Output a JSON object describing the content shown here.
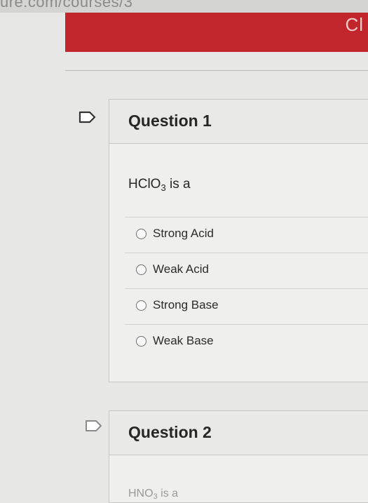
{
  "browser": {
    "url_fragment": "ure.com/courses/3"
  },
  "banner": {
    "corner_glyph": "Cl",
    "color": "#c0262c"
  },
  "questions": [
    {
      "title": "Question 1",
      "stem_prefix": "HClO",
      "stem_subscript": "3",
      "stem_suffix": " is a",
      "options": [
        {
          "label": "Strong Acid",
          "selected": false
        },
        {
          "label": "Weak Acid",
          "selected": false
        },
        {
          "label": "Strong Base",
          "selected": false
        },
        {
          "label": "Weak Base",
          "selected": false
        }
      ],
      "flag_icon": "flag-icon"
    },
    {
      "title": "Question 2",
      "stem_prefix": "HNO",
      "stem_subscript": "3",
      "stem_suffix": " is a",
      "flag_icon": "flag-icon"
    }
  ]
}
